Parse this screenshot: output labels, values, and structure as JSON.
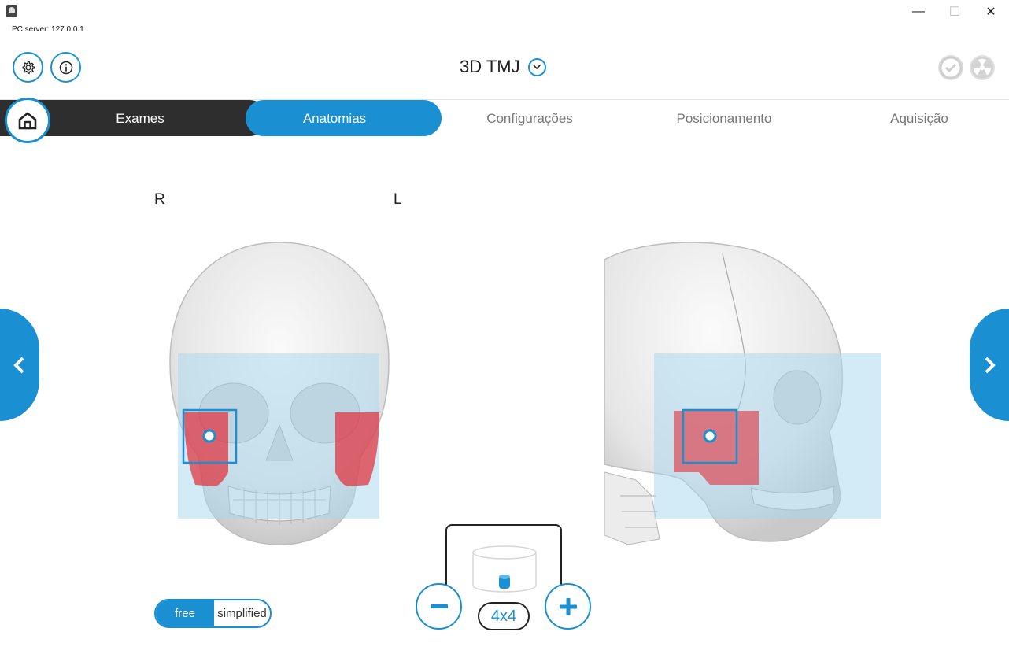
{
  "window": {
    "server_label": "PC server: 127.0.0.1",
    "minimize": "—",
    "maximize": "☐",
    "close": "✕"
  },
  "header": {
    "title": "3D TMJ"
  },
  "nav": {
    "exames": "Exames",
    "anatomias": "Anatomias",
    "configuracoes": "Configurações",
    "posicionamento": "Posicionamento",
    "aquisicao": "Aquisição"
  },
  "orientation": {
    "right": "R",
    "left": "L"
  },
  "mode_toggle": {
    "free": "free",
    "simplified": "simplified",
    "selected": "free"
  },
  "fov": {
    "label": "4x4"
  },
  "icons": {
    "settings": "gear-icon",
    "info": "info-icon",
    "home": "home-icon",
    "title_dropdown": "chevron-down-icon",
    "check": "check-icon",
    "radiation": "radiation-icon",
    "prev": "chevron-left-icon",
    "next": "chevron-right-icon"
  },
  "colors": {
    "accent": "#1a8fd1",
    "dark": "#2e2e2e",
    "roi": "#a8d8f0",
    "tmj": "#e0303c"
  }
}
